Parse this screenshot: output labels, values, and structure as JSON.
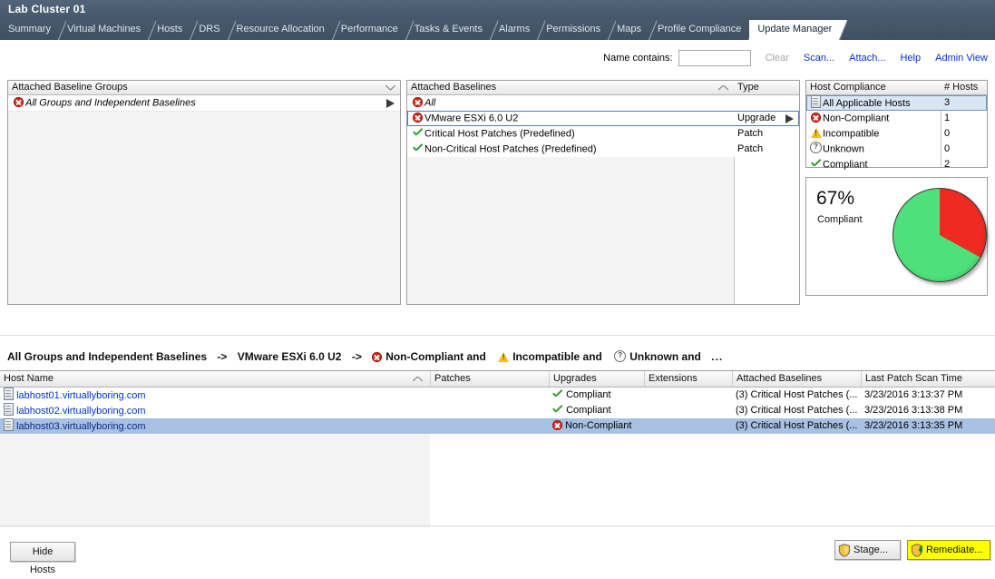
{
  "window": {
    "title": "Lab Cluster 01"
  },
  "tabs": [
    {
      "label": "Summary",
      "active": false
    },
    {
      "label": "Virtual Machines",
      "active": false
    },
    {
      "label": "Hosts",
      "active": false
    },
    {
      "label": "DRS",
      "active": false
    },
    {
      "label": "Resource Allocation",
      "active": false
    },
    {
      "label": "Performance",
      "active": false
    },
    {
      "label": "Tasks & Events",
      "active": false
    },
    {
      "label": "Alarms",
      "active": false
    },
    {
      "label": "Permissions",
      "active": false
    },
    {
      "label": "Maps",
      "active": false
    },
    {
      "label": "Profile Compliance",
      "active": false
    },
    {
      "label": "Update Manager",
      "active": true
    }
  ],
  "toolbar": {
    "name_contains_label": "Name contains:",
    "search_value": "",
    "search_placeholder": "",
    "clear_label": "Clear",
    "scan_label": "Scan...",
    "attach_label": "Attach...",
    "help_label": "Help",
    "admin_view_label": "Admin View"
  },
  "baseline_groups_panel": {
    "header": "Attached Baseline Groups",
    "rows": [
      {
        "icon": "error-icon",
        "label": "All Groups and Independent Baselines",
        "italic": true,
        "selected": false,
        "has_arrow": true
      }
    ]
  },
  "baselines_panel": {
    "header": "Attached Baselines",
    "type_header": "Type",
    "rows": [
      {
        "icon": "error-icon",
        "label": "All",
        "type": "",
        "italic": true,
        "selected": false,
        "has_arrow": false
      },
      {
        "icon": "error-icon",
        "label": "VMware ESXi 6.0 U2",
        "type": "Upgrade",
        "italic": false,
        "selected": true,
        "has_arrow": true
      },
      {
        "icon": "ok-icon",
        "label": "Critical Host Patches (Predefined)",
        "type": "Patch",
        "italic": false,
        "selected": false,
        "has_arrow": false
      },
      {
        "icon": "ok-icon",
        "label": "Non-Critical Host Patches (Predefined)",
        "type": "Patch",
        "italic": false,
        "selected": false,
        "has_arrow": false
      }
    ]
  },
  "host_compliance_panel": {
    "header": "Host Compliance",
    "count_header": "# Hosts",
    "rows": [
      {
        "icon": "host-icon",
        "label": "All Applicable Hosts",
        "count": "3",
        "selected": true
      },
      {
        "icon": "error-icon",
        "label": "Non-Compliant",
        "count": "1",
        "selected": false
      },
      {
        "icon": "warning-icon",
        "label": "Incompatible",
        "count": "0",
        "selected": false
      },
      {
        "icon": "unknown-icon",
        "label": "Unknown",
        "count": "0",
        "selected": false
      },
      {
        "icon": "ok-icon",
        "label": "Compliant",
        "count": "2",
        "selected": false
      }
    ]
  },
  "chart_data": {
    "type": "pie",
    "title": "",
    "percent_label": "67%",
    "percent_sublabel": "Compliant",
    "categories": [
      "Compliant",
      "Non-Compliant"
    ],
    "values": [
      67,
      33
    ],
    "colors": [
      "#4ee07a",
      "#ef2b21"
    ],
    "legend": "none",
    "start_angle_deg": 0,
    "direction": "clockwise"
  },
  "breadcrumb": {
    "part1": "All Groups and Independent Baselines",
    "arrow1": "->",
    "part2": "VMware ESXi 6.0 U2",
    "arrow2": "->",
    "filter1": "Non-Compliant and",
    "filter2": "Incompatible and",
    "filter3": "Unknown and",
    "ellipsis": "..."
  },
  "host_table": {
    "columns": [
      "Host Name",
      "Patches",
      "Upgrades",
      "Extensions",
      "Attached Baselines",
      "Last Patch Scan Time"
    ],
    "rows": [
      {
        "host": "labhost01.virtuallyboring.com",
        "patches": "",
        "upgrades": "Compliant",
        "upgrades_icon": "ok-icon",
        "extensions": "",
        "attached_baselines": "(3) Critical Host Patches (...",
        "last_patch_scan_time": "3/23/2016 3:13:37 PM",
        "selected": false
      },
      {
        "host": "labhost02.virtuallyboring.com",
        "patches": "",
        "upgrades": "Compliant",
        "upgrades_icon": "ok-icon",
        "extensions": "",
        "attached_baselines": "(3) Critical Host Patches (...",
        "last_patch_scan_time": "3/23/2016 3:13:38 PM",
        "selected": false
      },
      {
        "host": "labhost03.virtuallyboring.com",
        "patches": "",
        "upgrades": "Non-Compliant",
        "upgrades_icon": "error-icon",
        "extensions": "",
        "attached_baselines": "(3) Critical Host Patches (...",
        "last_patch_scan_time": "3/23/2016 3:13:35 PM",
        "selected": true
      }
    ]
  },
  "bottom_bar": {
    "hide_hosts_label": "Hide Hosts",
    "stage_label": "Stage...",
    "remediate_label": "Remediate...",
    "remediate_highlight_color": "#ffff00"
  }
}
